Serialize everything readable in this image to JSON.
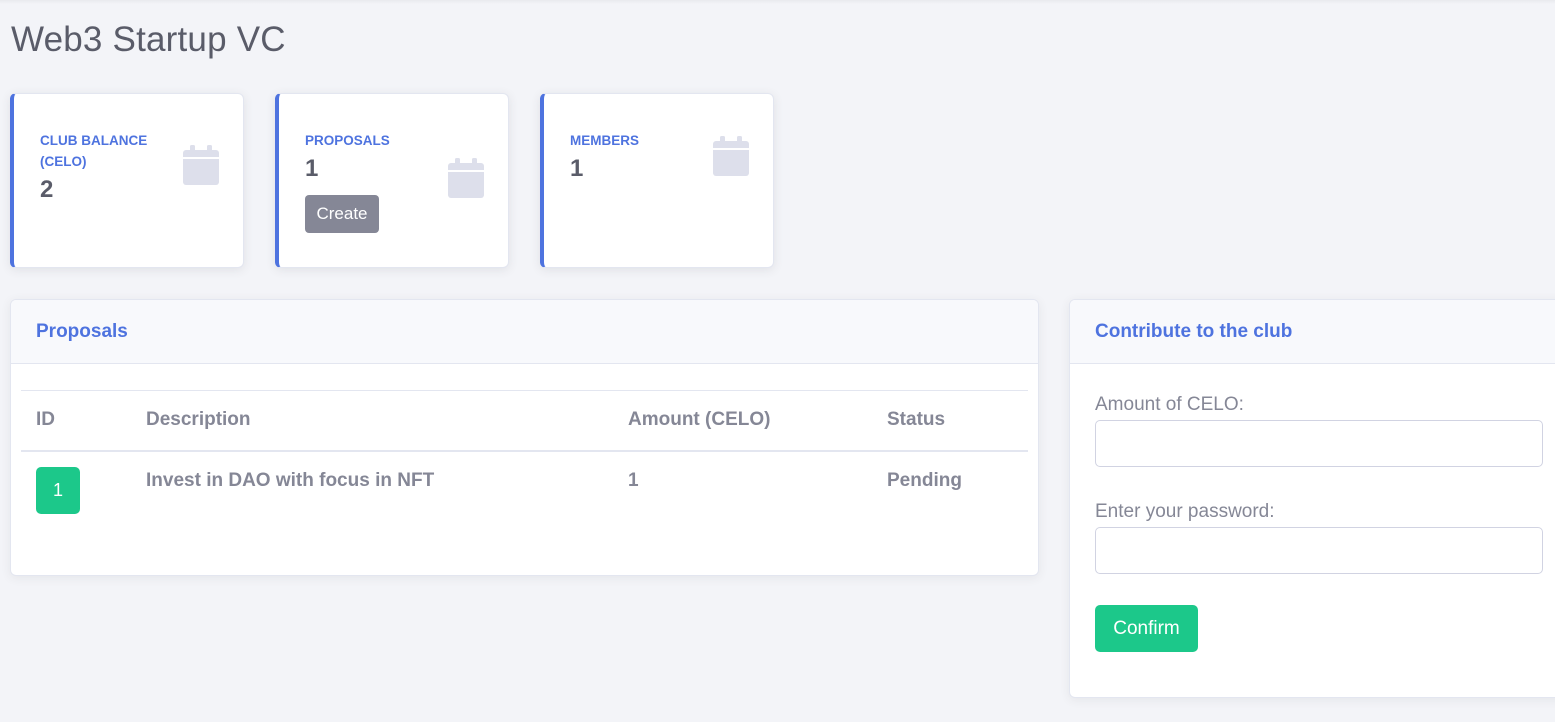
{
  "page": {
    "title": "Web3 Startup VC"
  },
  "stats": [
    {
      "label": "CLUB BALANCE (CELO)",
      "value": "2",
      "icon": "calendar-icon"
    },
    {
      "label": "PROPOSALS",
      "value": "1",
      "icon": "calendar-icon",
      "button_label": "Create"
    },
    {
      "label": "MEMBERS",
      "value": "1",
      "icon": "calendar-icon"
    }
  ],
  "proposals_panel": {
    "title": "Proposals",
    "columns": [
      "ID",
      "Description",
      "Amount (CELO)",
      "Status"
    ],
    "rows": [
      {
        "id": "1",
        "description": "Invest in DAO with focus in NFT",
        "amount": "1",
        "status": "Pending"
      }
    ]
  },
  "contribute_panel": {
    "title": "Contribute to the club",
    "amount_label": "Amount of CELO:",
    "amount_value": "",
    "password_label": "Enter your password:",
    "password_value": "",
    "confirm_label": "Confirm"
  },
  "colors": {
    "primary": "#4e73df",
    "success": "#1cc88a",
    "secondary": "#858796",
    "text": "#5a5c69",
    "background": "#f3f4f8"
  }
}
